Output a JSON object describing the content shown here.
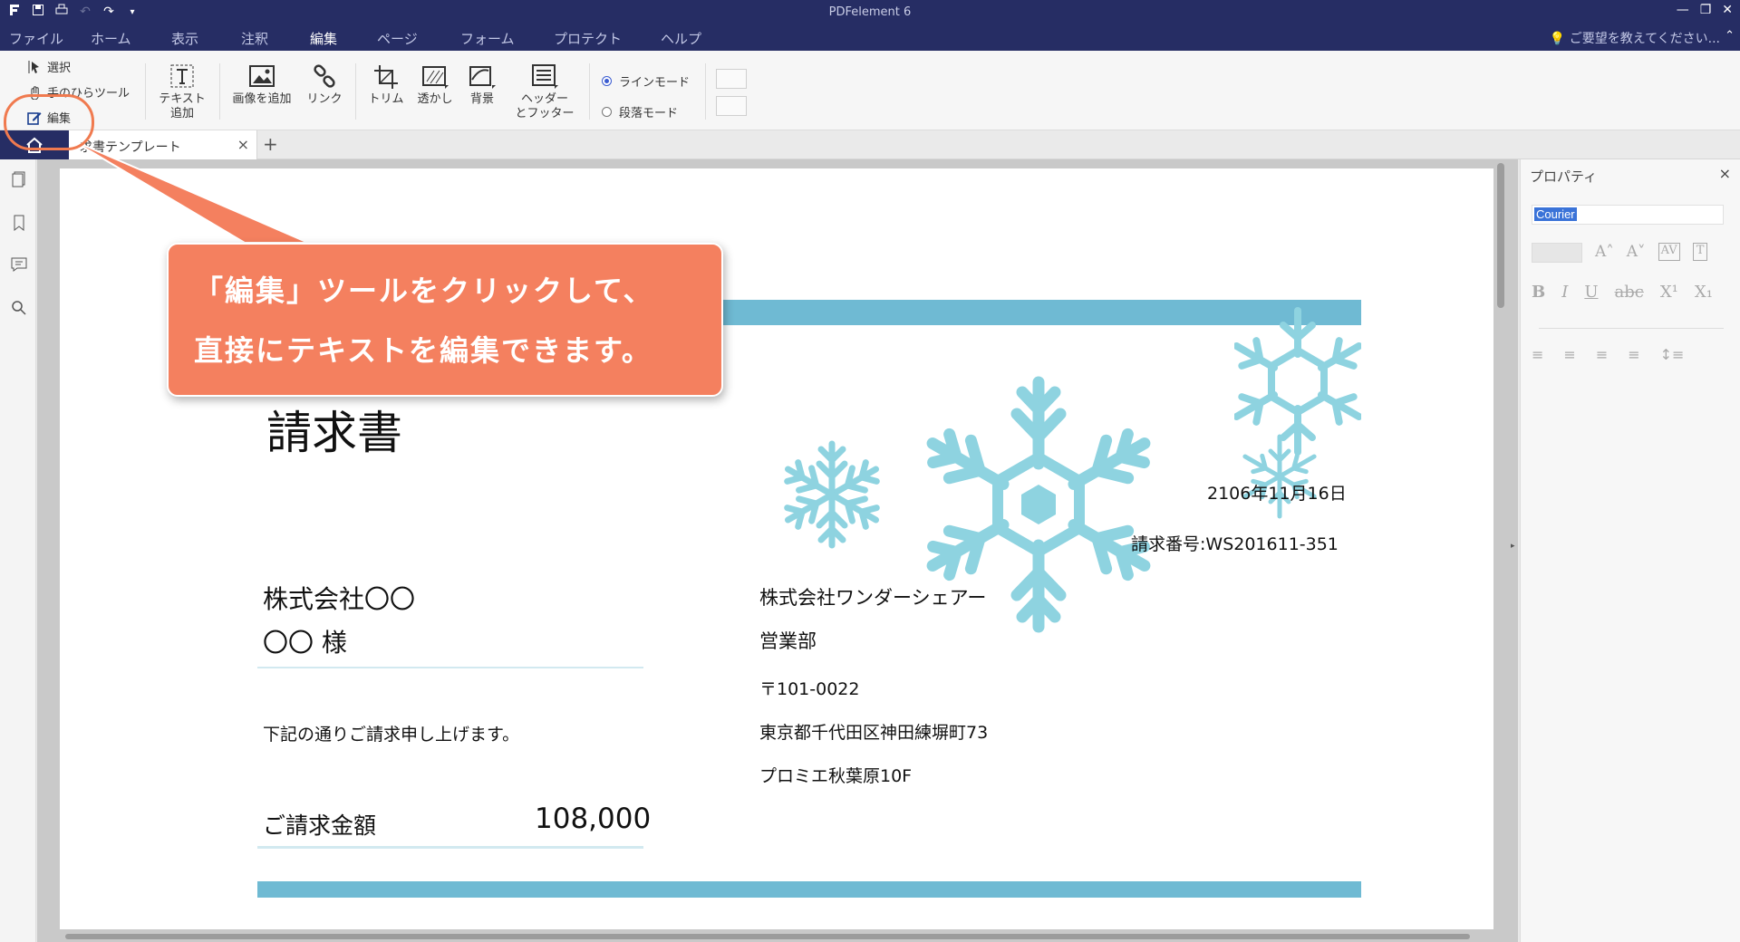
{
  "app": {
    "title": "PDFelement 6",
    "window_controls": [
      "—",
      "❐",
      "✕"
    ]
  },
  "menu": {
    "items": [
      "ファイル",
      "ホーム",
      "表示",
      "注釈",
      "編集",
      "ページ",
      "フォーム",
      "プロテクト",
      "ヘルプ"
    ],
    "active": "編集",
    "help_prompt": "ご要望を教えてください..."
  },
  "ribbon": {
    "select_label": "選択",
    "hand_label": "手のひらツール",
    "edit_label": "編集",
    "add_text_line1": "テキスト",
    "add_text_line2": "追加",
    "add_image": "画像を追加",
    "link": "リンク",
    "trim": "トリム",
    "watermark": "透かし",
    "background": "背景",
    "header_footer_line1": "ヘッダー",
    "header_footer_line2": "とフッター",
    "line_mode": "ラインモード",
    "paragraph_mode": "段落モード",
    "selected_mode": "line"
  },
  "tabs": {
    "doc_tab": "請求書テンプレート",
    "doc_tab_visible": "求書テンプレート",
    "new_tab": "+"
  },
  "document": {
    "title": "請求書",
    "date": "2106年11月16日",
    "invoice_number": "請求番号:WS201611-351",
    "client_company": "株式会社〇〇",
    "client_person": "〇〇 様",
    "message": "下記の通りご請求申し上げます。",
    "amount_label": "ご請求金額",
    "amount_value": "108,000",
    "sender_company": "株式会社ワンダーシェアー",
    "sender_dept": "営業部",
    "sender_postal": "〒101-0022",
    "sender_address": "東京都千代田区神田練塀町73",
    "sender_building": "プロミエ秋葉原10F",
    "accent_color": "#6fbad3",
    "snow_color": "#8ed3e0"
  },
  "properties": {
    "title": "プロパティ",
    "font_name": "Courier",
    "format_buttons": [
      "A˄",
      "A˅",
      "AV",
      "T"
    ],
    "style_buttons": [
      "B",
      "I",
      "U",
      "abc",
      "X¹",
      "X₁"
    ]
  },
  "callout": {
    "line1": "「編集」ツールをクリックして、",
    "line2": "直接にテキストを編集できます。",
    "color": "#f4805f"
  }
}
